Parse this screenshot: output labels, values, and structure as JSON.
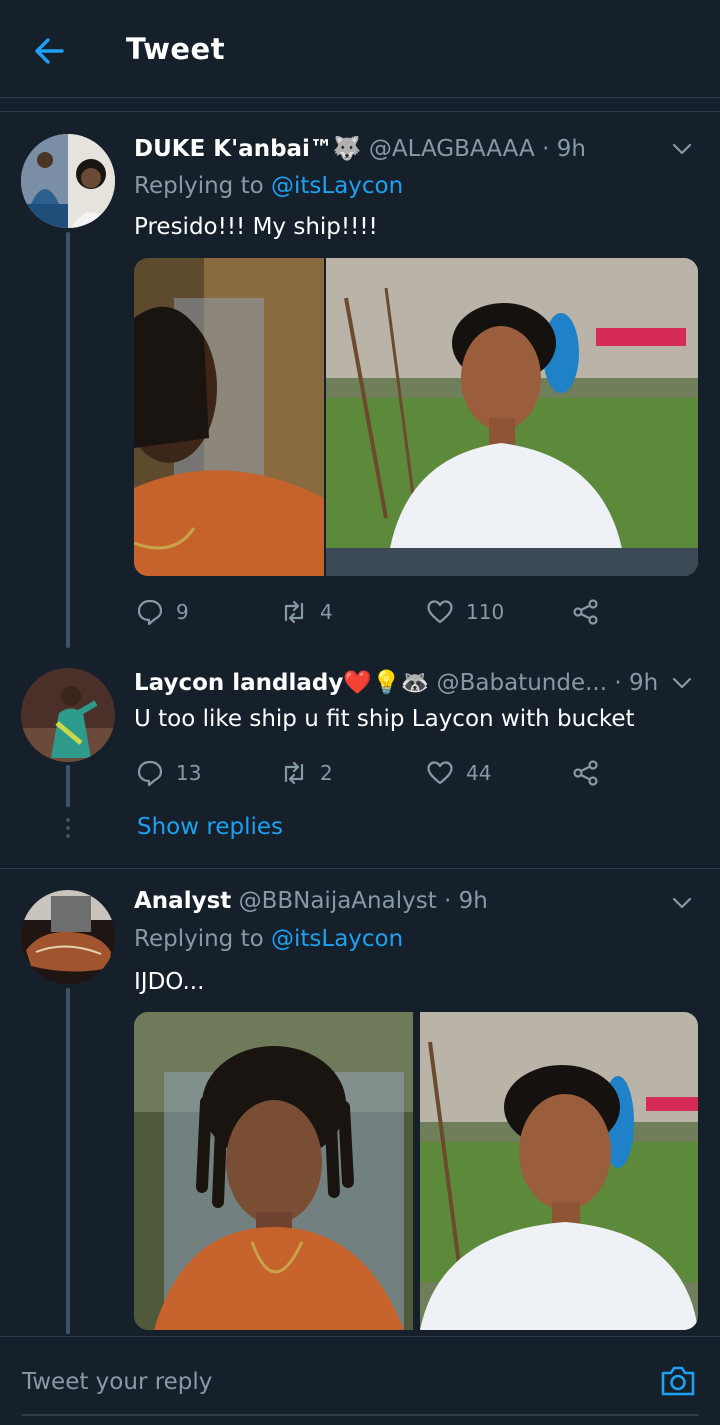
{
  "header": {
    "title": "Tweet",
    "back_icon": "arrow-left-icon"
  },
  "colors": {
    "background": "#15202b",
    "accent": "#1da1f2",
    "muted": "#8899a6",
    "divider": "#2f3d4a"
  },
  "tweets": [
    {
      "display_name": "DUKE K'anbai™🐺",
      "handle": "@ALAGBAAAA",
      "sep": "·",
      "time": "9h",
      "replying_prefix": "Replying to",
      "replying_handle": "@itsLaycon",
      "text": "Presido!!! My ship!!!!",
      "media_count": 2,
      "replies": "9",
      "retweets": "4",
      "likes": "110"
    },
    {
      "display_name": "Laycon landlady❤️💡🦝",
      "handle": "@Babatunde...",
      "sep": "·",
      "time": "9h",
      "text": "U too like ship u fit ship Laycon with bucket",
      "replies": "13",
      "retweets": "2",
      "likes": "44"
    },
    {
      "display_name": "Analyst",
      "handle": "@BBNaijaAnalyst",
      "sep": "·",
      "time": "9h",
      "replying_prefix": "Replying to",
      "replying_handle": "@itsLaycon",
      "text": "IJDO...",
      "media_count": 2
    }
  ],
  "show_replies": "Show replies",
  "reply_bar": {
    "placeholder": "Tweet your reply",
    "camera_icon": "camera-icon"
  }
}
